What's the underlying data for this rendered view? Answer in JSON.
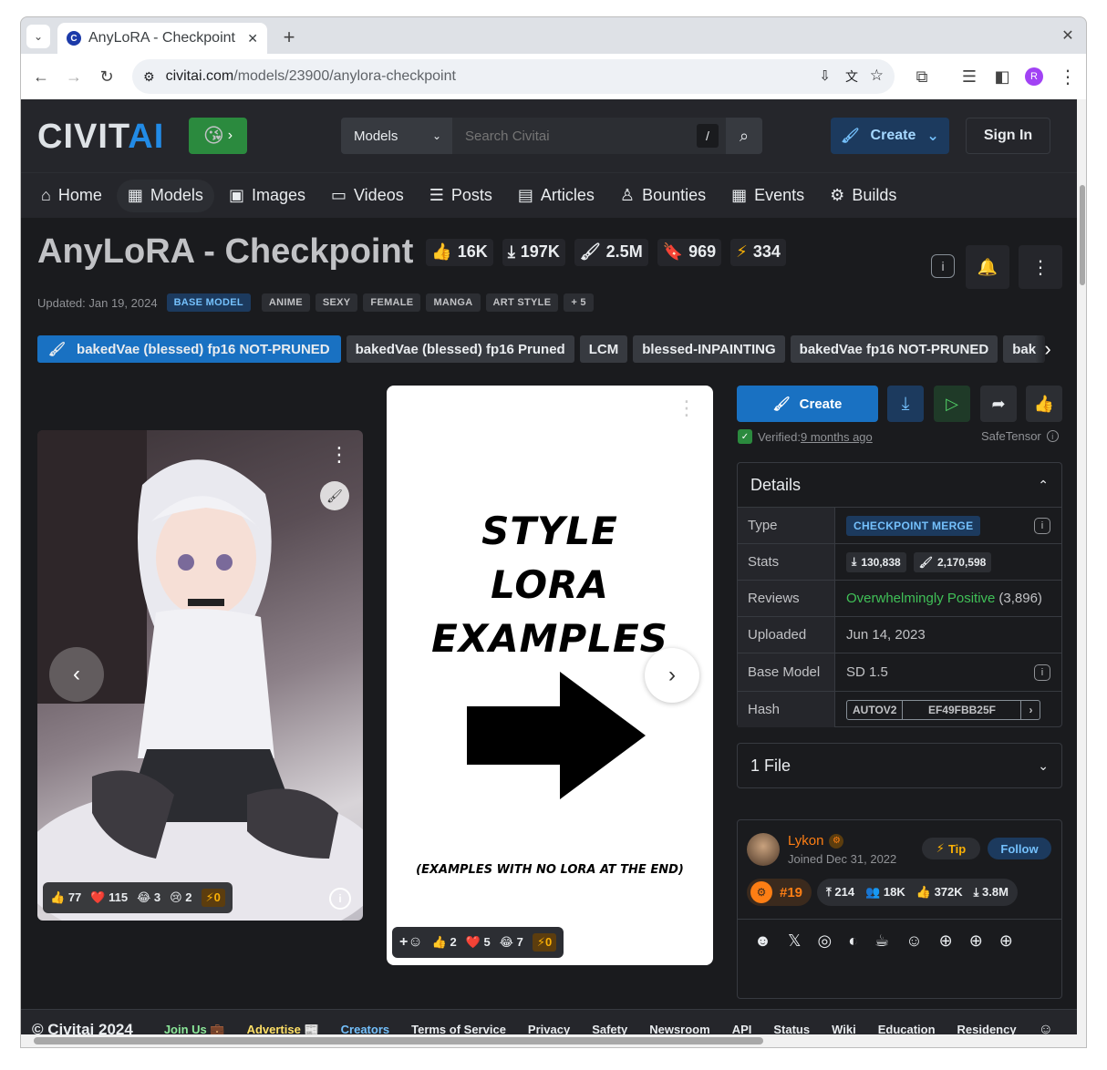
{
  "browser": {
    "tab_title": "AnyLoRA - Checkpoint",
    "url_domain": "civitai.com",
    "url_path": "/models/23900/anylora-checkpoint",
    "profile_initial": "R"
  },
  "header": {
    "logo": "CIVITAI",
    "search_scope": "Models",
    "search_placeholder": "Search Civitai",
    "search_shortcut": "/",
    "create_label": "Create",
    "signin_label": "Sign In"
  },
  "menu": [
    {
      "label": "Home",
      "icon": "home-icon"
    },
    {
      "label": "Models",
      "icon": "grid-icon",
      "active": true
    },
    {
      "label": "Images",
      "icon": "image-icon"
    },
    {
      "label": "Videos",
      "icon": "video-icon"
    },
    {
      "label": "Posts",
      "icon": "posts-icon"
    },
    {
      "label": "Articles",
      "icon": "article-icon"
    },
    {
      "label": "Bounties",
      "icon": "bounty-icon"
    },
    {
      "label": "Events",
      "icon": "calendar-icon"
    },
    {
      "label": "Builds",
      "icon": "cpu-icon"
    }
  ],
  "model": {
    "title": "AnyLoRA - Checkpoint",
    "likes": "16K",
    "downloads": "197K",
    "generations": "2.5M",
    "bookmarks": "969",
    "buzz": "334",
    "updated": "Updated: Jan 19, 2024",
    "base_badge": "BASE MODEL",
    "tags": [
      "ANIME",
      "SEXY",
      "FEMALE",
      "MANGA",
      "ART STYLE"
    ],
    "more_tags": "+ 5"
  },
  "versions": [
    "bakedVae (blessed) fp16 NOT-PRUNED",
    "bakedVae (blessed) fp16 Pruned",
    "LCM",
    "blessed-INPAINTING",
    "bakedVae fp16 NOT-PRUNED",
    "bak"
  ],
  "gallery": {
    "card1": {
      "reactions": {
        "like": "77",
        "heart": "115",
        "laugh": "3",
        "cry": "2",
        "buzz": "0"
      }
    },
    "card2": {
      "lines": [
        "STYLE",
        "LORA",
        "EXAMPLES"
      ],
      "footnote": "(EXAMPLES WITH NO LORA AT THE END)",
      "reactions": {
        "like": "2",
        "heart": "5",
        "laugh": "7",
        "buzz": "0"
      }
    }
  },
  "side": {
    "create_label": "Create",
    "verified_prefix": "Verified: ",
    "verified_time": "9 months ago",
    "format": "SafeTensor",
    "details_title": "Details",
    "details": {
      "type_k": "Type",
      "type_v": "CHECKPOINT MERGE",
      "stats_k": "Stats",
      "stats_dl": "130,838",
      "stats_gen": "2,170,598",
      "reviews_k": "Reviews",
      "reviews_v": "Overwhelmingly Positive",
      "reviews_count": "(3,896)",
      "uploaded_k": "Uploaded",
      "uploaded_v": "Jun 14, 2023",
      "base_k": "Base Model",
      "base_v": "SD 1.5",
      "hash_k": "Hash",
      "hash_type": "AUTOV2",
      "hash_v": "EF49FBB25F"
    },
    "files_label": "1 File",
    "creator": {
      "name": "Lykon",
      "joined": "Joined Dec 31, 2022",
      "tip": "Tip",
      "follow": "Follow",
      "rank": "#19",
      "uploads": "214",
      "followers": "18K",
      "likes": "372K",
      "downloads": "3.8M"
    }
  },
  "footer": {
    "copyright": "© Civitai 2024",
    "join": "Join Us 💼",
    "advertise": "Advertise 📰",
    "creators": "Creators",
    "links": [
      "Terms of Service",
      "Privacy",
      "Safety",
      "Newsroom",
      "API",
      "Status",
      "Wiki",
      "Education",
      "Residency"
    ]
  },
  "colors": {
    "accent": "#228be6",
    "dark_bg": "#1a1b1e",
    "panel": "#25262b",
    "green": "#40c057",
    "buzz": "#fab005",
    "orange": "#fd7e14"
  }
}
